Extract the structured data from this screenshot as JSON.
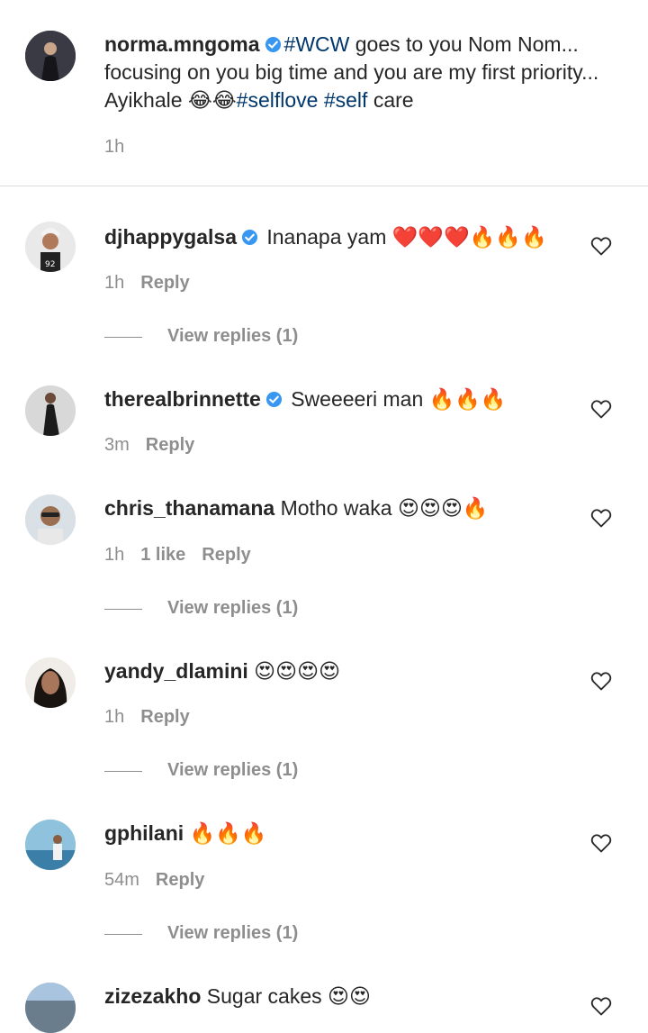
{
  "caption": {
    "username": "norma.mngoma",
    "hashtag_wcw": "#WCW",
    "text_1": " goes to you Nom Nom... focusing on you big time and you are my first priority... Ayikhale ",
    "emoji": "😂😂",
    "hashtag_selflove": "#selflove",
    "hashtag_self": "#self",
    "text_2": " care",
    "time": "1h"
  },
  "labels": {
    "reply": "Reply",
    "view_replies": "View replies (1)"
  },
  "comments": [
    {
      "username": "djhappygalsa",
      "verified": true,
      "text": " Inanapa yam ",
      "emoji": "❤️❤️❤️🔥🔥🔥",
      "time": "1h",
      "likes": ""
    },
    {
      "username": "therealbrinnette",
      "verified": true,
      "text": " Sweeeeri man ",
      "emoji": "🔥🔥🔥",
      "time": "3m",
      "likes": ""
    },
    {
      "username": "chris_thanamana",
      "verified": false,
      "text": " Motho waka ",
      "emoji": "😍😍😍🔥",
      "time": "1h",
      "likes": "1 like"
    },
    {
      "username": "yandy_dlamini",
      "verified": false,
      "text": " ",
      "emoji": "😍😍😍😍",
      "time": "1h",
      "likes": ""
    },
    {
      "username": "gphilani",
      "verified": false,
      "text": " ",
      "emoji": "🔥🔥🔥",
      "time": "54m",
      "likes": ""
    },
    {
      "username": "zizezakho",
      "verified": false,
      "text": " Sugar cakes ",
      "emoji": "😍😍",
      "time": "",
      "likes": ""
    }
  ],
  "colors": {
    "text": "#262626",
    "secondary": "#8e8e8e",
    "hashtag": "#00376b",
    "verified": "#3897f0",
    "divider": "#dbdbdb"
  }
}
